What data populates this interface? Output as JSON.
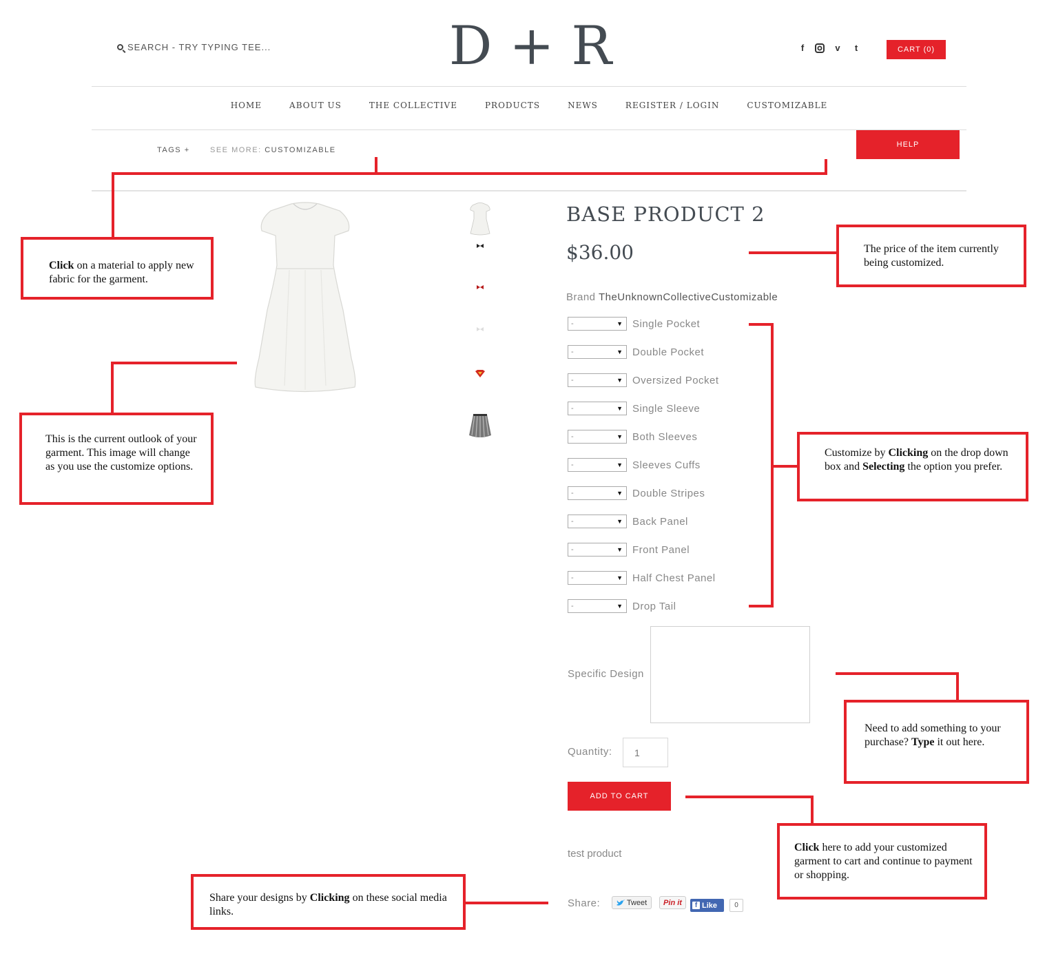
{
  "header": {
    "search_placeholder": "SEARCH - TRY TYPING TEE...",
    "logo": "D + R",
    "social": [
      "f",
      "◙",
      "v",
      "t"
    ],
    "cart_label": "CART (0)"
  },
  "nav": [
    "HOME",
    "ABOUT US",
    "THE COLLECTIVE",
    "PRODUCTS",
    "NEWS",
    "REGISTER / LOGIN",
    "CUSTOMIZABLE"
  ],
  "breadcrumb": {
    "tags": "TAGS +",
    "see_more_prefix": "SEE MORE: ",
    "see_more_value": "CUSTOMIZABLE"
  },
  "help_label": "HELP",
  "product": {
    "title": "BASE PRODUCT 2",
    "price": "$36.00",
    "brand_label": "Brand",
    "brand_value": "TheUnknownCollectiveCustomizable",
    "select_value": "-",
    "options": [
      "Single Pocket",
      "Double Pocket",
      "Oversized Pocket",
      "Single Sleeve",
      "Both Sleeves",
      "Sleeves Cuffs",
      "Double Stripes",
      "Back Panel",
      "Front Panel",
      "Half Chest Panel",
      "Drop Tail"
    ],
    "specific_design_label": "Specific Design",
    "quantity_label": "Quantity:",
    "quantity_value": "1",
    "add_to_cart_label": "ADD TO CART",
    "description": "test product",
    "share_label": "Share:",
    "tweet_label": "Tweet",
    "pin_label": "Pin it",
    "like_label": "Like",
    "like_count": "0"
  },
  "annotations": {
    "material": {
      "bold": "Click",
      "rest": " on a material to apply new fabric for the garment."
    },
    "outlook": "This is the current outlook of your garment.  This image will change as you use the customize options.",
    "price": "The price of the item currently being customized.",
    "customize": {
      "p1": "Customize by ",
      "b1": "Clicking",
      "p2": " on the drop down box and ",
      "b2": "Selecting",
      "p3": " the option you prefer."
    },
    "design": {
      "p1": "Need to add something to your purchase?  ",
      "b1": "Type",
      "p2": " it out here."
    },
    "cart": {
      "b1": "Click",
      "p1": " here to add your customized garment to cart and continue to payment or shopping."
    },
    "share": {
      "p1": "Share your designs by ",
      "b1": "Clicking",
      "p2": " on these social media links."
    }
  },
  "colors": {
    "accent": "#e5222a",
    "logo": "#444b52"
  }
}
